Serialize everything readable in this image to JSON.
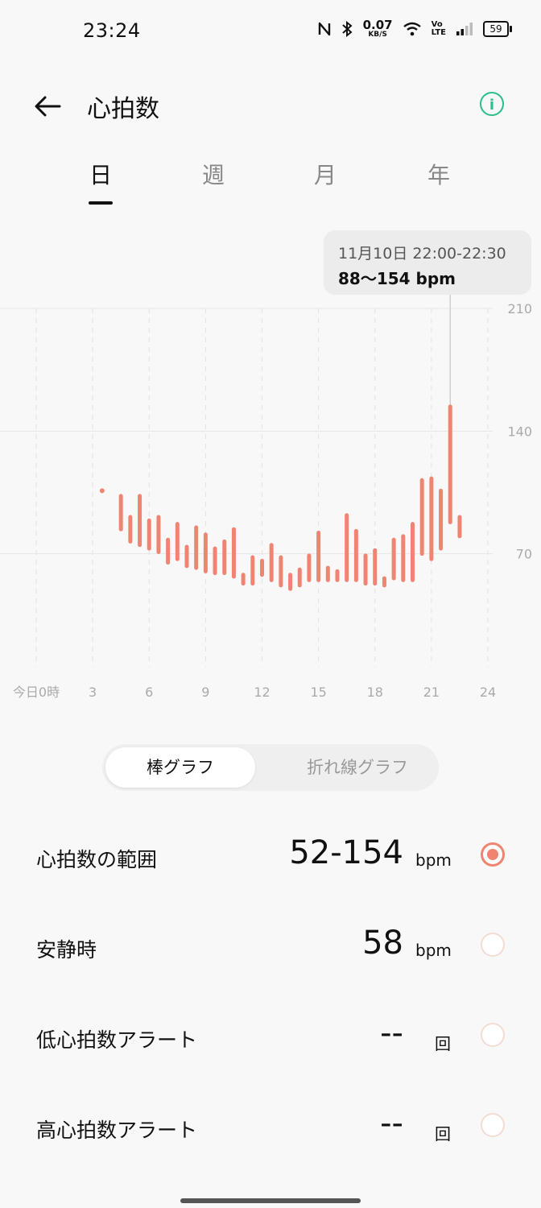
{
  "status_bar": {
    "time": "23:24",
    "nfc_icon": "nfc-icon",
    "bluetooth_icon": "bluetooth-icon",
    "net_speed_value": "0.07",
    "net_speed_unit": "KB/S",
    "wifi_icon": "wifi-icon",
    "volte_top": "Vo",
    "volte_bottom": "LTE",
    "signal_icon": "signal-icon",
    "battery": "59"
  },
  "header": {
    "title": "心拍数",
    "back_icon": "back-arrow-icon",
    "info_icon": "info-icon",
    "info_glyph": "i"
  },
  "tabs": [
    {
      "label": "日",
      "active": true
    },
    {
      "label": "週",
      "active": false
    },
    {
      "label": "月",
      "active": false
    },
    {
      "label": "年",
      "active": false
    }
  ],
  "tooltip": {
    "date_range": "11月10日 22:00-22:30",
    "value_range": "88〜154 bpm"
  },
  "chart_data": {
    "type": "bar",
    "ylim": [
      0,
      210
    ],
    "xlim": [
      0,
      24
    ],
    "y_ticks": [
      "210",
      "140",
      "70"
    ],
    "y_tick_values": [
      210,
      140,
      70
    ],
    "x_ticks": [
      "今日0時",
      "3",
      "6",
      "9",
      "12",
      "15",
      "18",
      "21",
      "24"
    ],
    "x_tick_values": [
      0,
      3,
      6,
      9,
      12,
      15,
      18,
      21,
      24
    ],
    "grid": true,
    "bar_color": "#ef8472",
    "highlight_x": 22.0,
    "bars": [
      {
        "x": 3.5,
        "low": 106,
        "high": 106
      },
      {
        "x": 4.5,
        "low": 84,
        "high": 103
      },
      {
        "x": 5.0,
        "low": 77,
        "high": 91
      },
      {
        "x": 5.5,
        "low": 75,
        "high": 103
      },
      {
        "x": 6.0,
        "low": 73,
        "high": 89
      },
      {
        "x": 6.5,
        "low": 71,
        "high": 91
      },
      {
        "x": 7.0,
        "low": 65,
        "high": 78
      },
      {
        "x": 7.5,
        "low": 67,
        "high": 87
      },
      {
        "x": 8.0,
        "low": 63,
        "high": 74
      },
      {
        "x": 8.5,
        "low": 62,
        "high": 85
      },
      {
        "x": 9.0,
        "low": 60,
        "high": 81
      },
      {
        "x": 9.5,
        "low": 59,
        "high": 73
      },
      {
        "x": 10.0,
        "low": 59,
        "high": 77
      },
      {
        "x": 10.5,
        "low": 57,
        "high": 84
      },
      {
        "x": 11.0,
        "low": 53,
        "high": 58
      },
      {
        "x": 11.5,
        "low": 53,
        "high": 68
      },
      {
        "x": 12.0,
        "low": 58,
        "high": 66
      },
      {
        "x": 12.5,
        "low": 55,
        "high": 75
      },
      {
        "x": 13.0,
        "low": 52,
        "high": 68
      },
      {
        "x": 13.5,
        "low": 50,
        "high": 58
      },
      {
        "x": 14.0,
        "low": 52,
        "high": 61
      },
      {
        "x": 14.5,
        "low": 55,
        "high": 69
      },
      {
        "x": 15.0,
        "low": 55,
        "high": 82
      },
      {
        "x": 15.5,
        "low": 55,
        "high": 62
      },
      {
        "x": 16.0,
        "low": 55,
        "high": 60
      },
      {
        "x": 16.5,
        "low": 55,
        "high": 92
      },
      {
        "x": 17.0,
        "low": 55,
        "high": 83
      },
      {
        "x": 17.5,
        "low": 53,
        "high": 69
      },
      {
        "x": 18.0,
        "low": 53,
        "high": 72
      },
      {
        "x": 18.5,
        "low": 52,
        "high": 56
      },
      {
        "x": 19.0,
        "low": 56,
        "high": 78
      },
      {
        "x": 19.5,
        "low": 55,
        "high": 80
      },
      {
        "x": 20.0,
        "low": 55,
        "high": 87
      },
      {
        "x": 20.5,
        "low": 70,
        "high": 112
      },
      {
        "x": 21.0,
        "low": 67,
        "high": 113
      },
      {
        "x": 21.5,
        "low": 73,
        "high": 106
      },
      {
        "x": 22.0,
        "low": 88,
        "high": 154
      },
      {
        "x": 22.5,
        "low": 80,
        "high": 91
      }
    ]
  },
  "segmented": {
    "bar_label": "棒グラフ",
    "line_label": "折れ線グラフ"
  },
  "metrics": [
    {
      "label": "心拍数の範囲",
      "value": "52-154",
      "unit": "bpm",
      "checked": true
    },
    {
      "label": "安静時",
      "value": "58",
      "unit": "bpm",
      "checked": false
    },
    {
      "label": "低心拍数アラート",
      "value": "--",
      "unit": "回",
      "checked": false
    },
    {
      "label": "高心拍数アラート",
      "value": "--",
      "unit": "回",
      "checked": false
    }
  ],
  "colors": {
    "accent_green": "#2bbf8a",
    "bar": "#ef8472"
  }
}
